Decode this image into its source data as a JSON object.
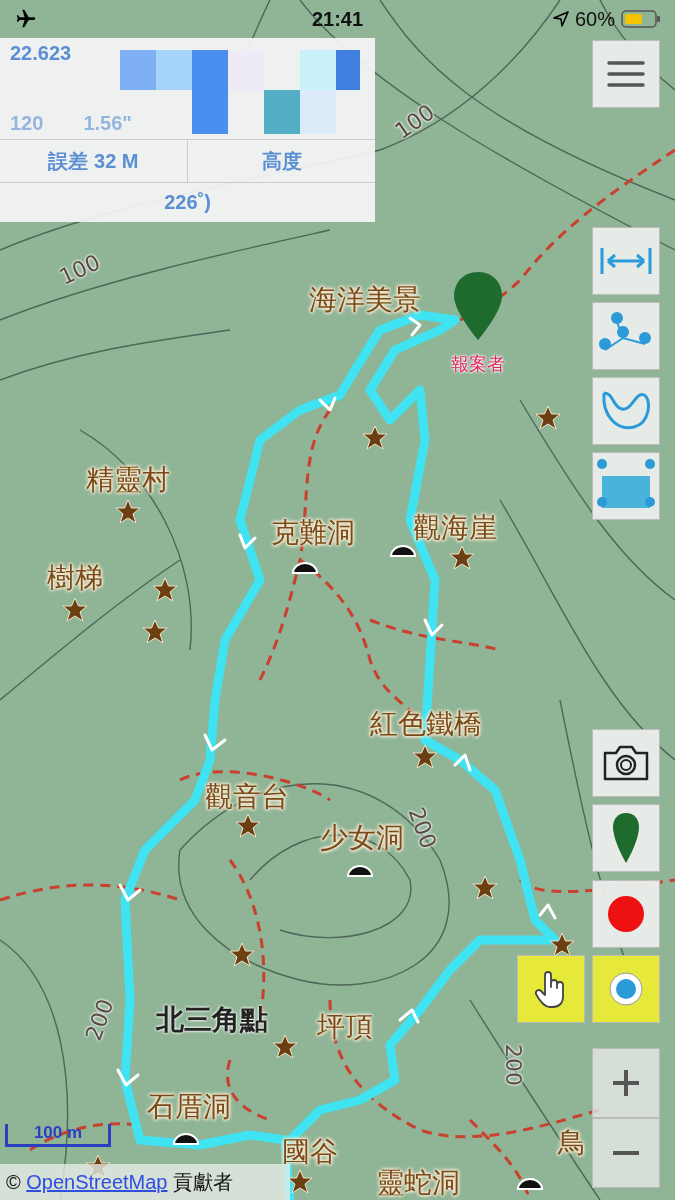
{
  "status_bar": {
    "time": "21:41",
    "battery_text": "60%"
  },
  "info_panel": {
    "lat": "22.623",
    "lon_deg": "120",
    "lon_sec": "1.56\"",
    "accuracy": "誤差 32 M",
    "altitude": "高度",
    "heading": "226˚)"
  },
  "map_labels": [
    {
      "text": "100",
      "kind": "contour"
    },
    {
      "text": "100",
      "kind": "contour"
    },
    {
      "text": "海洋美景",
      "kind": "place"
    },
    {
      "text": "報案者",
      "kind": "reporter"
    },
    {
      "text": "精靈村",
      "kind": "place"
    },
    {
      "text": "樹梯",
      "kind": "place"
    },
    {
      "text": "克難洞",
      "kind": "place"
    },
    {
      "text": "觀海崖",
      "kind": "place"
    },
    {
      "text": "紅色鐵橋",
      "kind": "place"
    },
    {
      "text": "觀音台",
      "kind": "place"
    },
    {
      "text": "少女洞",
      "kind": "place"
    },
    {
      "text": "200",
      "kind": "contour"
    },
    {
      "text": "北三角點",
      "kind": "landmark"
    },
    {
      "text": "坪頂",
      "kind": "place"
    },
    {
      "text": "200",
      "kind": "contour"
    },
    {
      "text": "200",
      "kind": "contour"
    },
    {
      "text": "石厝洞",
      "kind": "place"
    },
    {
      "text": "國谷",
      "kind": "place"
    },
    {
      "text": "鳥",
      "kind": "place"
    },
    {
      "text": "靈蛇洞",
      "kind": "place"
    }
  ],
  "scale_bar": "100 m",
  "attribution": {
    "prefix": "©",
    "link": "OpenStreetMap",
    "suffix": "貢獻者"
  },
  "tools": [
    {
      "kind": "menu",
      "selected": false
    },
    {
      "kind": "measure",
      "selected": false
    },
    {
      "kind": "route",
      "selected": false
    },
    {
      "kind": "freehand",
      "selected": false
    },
    {
      "kind": "area",
      "selected": false
    },
    {
      "kind": "camera",
      "selected": false
    },
    {
      "kind": "pin",
      "selected": false
    },
    {
      "kind": "record",
      "selected": false
    },
    {
      "kind": "pan",
      "selected": true
    },
    {
      "kind": "locate",
      "selected": true
    },
    {
      "kind": "zoom_in",
      "selected": false
    },
    {
      "kind": "zoom_out",
      "selected": false
    }
  ]
}
